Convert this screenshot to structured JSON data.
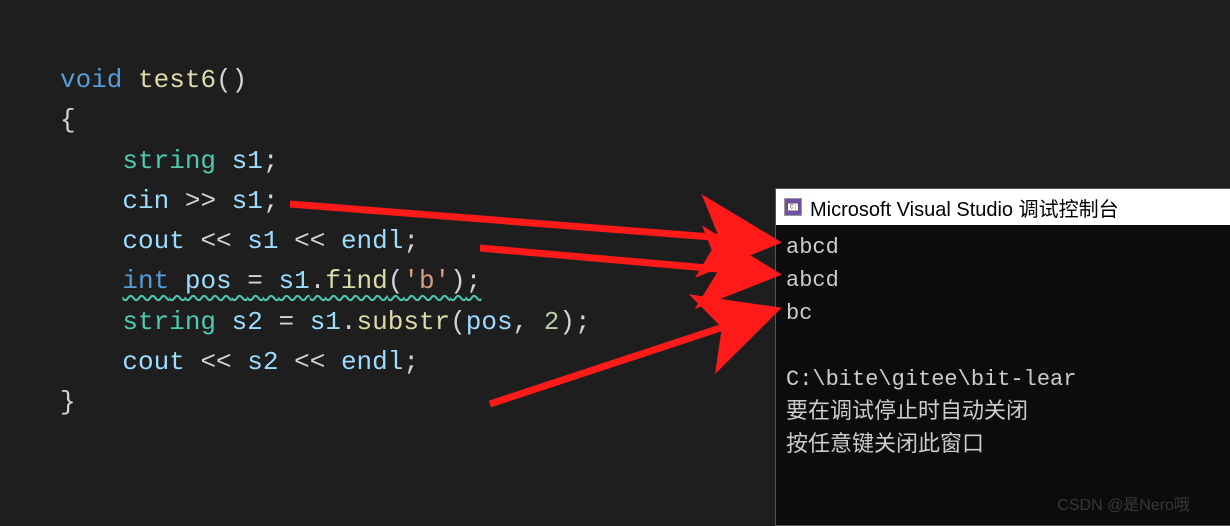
{
  "code": {
    "keyword_void": "void",
    "function_name": "test6",
    "open_paren": "(",
    "close_paren": ")",
    "open_brace": "{",
    "close_brace": "}",
    "type_string": "string",
    "type_int": "int",
    "var_s1": "s1",
    "var_s2": "s2",
    "var_pos": "pos",
    "var_cin": "cin",
    "var_cout": "cout",
    "var_endl": "endl",
    "op_extract": ">>",
    "op_insert": "<<",
    "op_assign": "=",
    "method_find": "find",
    "method_substr": "substr",
    "char_b": "'b'",
    "num_2": "2",
    "dot": ".",
    "comma": ",",
    "semi": ";"
  },
  "console": {
    "title": "Microsoft Visual Studio 调试控制台",
    "lines": {
      "l1": "abcd",
      "l2": "abcd",
      "l3": "bc",
      "l4": "",
      "l5": "C:\\bite\\gitee\\bit-lear",
      "l6": "要在调试停止时自动关闭",
      "l7": "按任意键关闭此窗口"
    }
  },
  "watermark": "CSDN @是Nero哦"
}
